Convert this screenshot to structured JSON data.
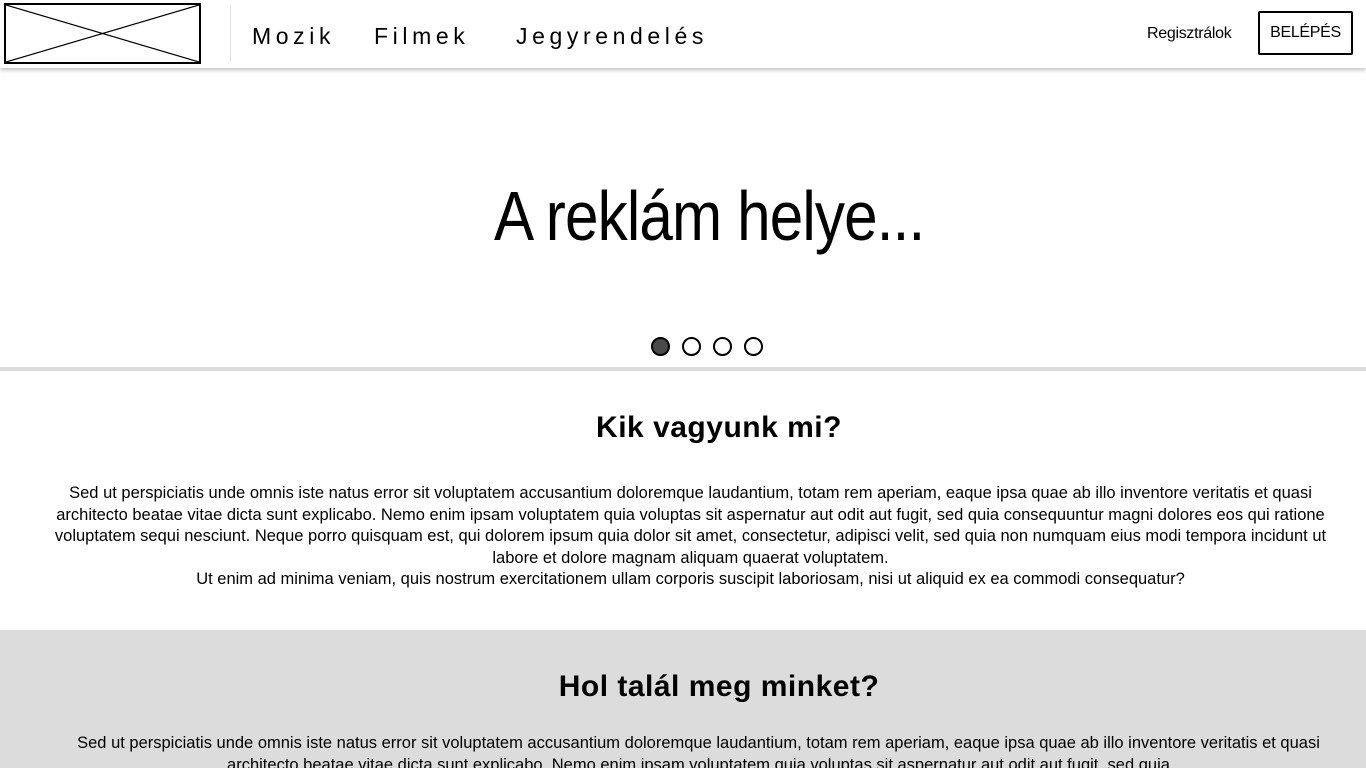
{
  "header": {
    "logo_alt": "",
    "nav": [
      {
        "label": "Mozik"
      },
      {
        "label": "Filmek"
      },
      {
        "label": "Jegyrendelés"
      }
    ],
    "register_label": "Regisztrálok",
    "login_label": "BELÉPÉS"
  },
  "hero": {
    "text": "A reklám helye...",
    "slides_count": 4,
    "active_slide": 1
  },
  "about": {
    "title": "Kik vagyunk mi?",
    "paragraph1": "Sed ut perspiciatis unde omnis iste natus error sit voluptatem accusantium doloremque laudantium, totam rem aperiam, eaque ipsa quae ab illo inventore veritatis et quasi architecto beatae vitae dicta sunt explicabo. Nemo enim ipsam voluptatem quia voluptas sit aspernatur aut odit aut fugit, sed quia consequuntur magni dolores eos qui ratione voluptatem sequi nesciunt. Neque porro quisquam est, qui dolorem ipsum quia dolor sit amet, consectetur, adipisci velit, sed quia non numquam eius modi tempora incidunt ut labore et dolore magnam aliquam quaerat voluptatem.",
    "paragraph2": "Ut enim ad minima veniam, quis nostrum exercitationem ullam corporis suscipit laboriosam, nisi ut aliquid ex ea commodi consequatur?"
  },
  "location": {
    "title": "Hol talál meg minket?",
    "paragraph1": "Sed ut perspiciatis unde omnis iste natus error sit voluptatem accusantium doloremque laudantium, totam rem aperiam, eaque ipsa quae ab illo inventore veritatis et quasi architecto beatae vitae dicta sunt explicabo. Nemo enim ipsam voluptatem quia voluptas sit aspernatur aut odit aut fugit, sed quia"
  },
  "colors": {
    "background": "#ffffff",
    "section_gray": "#dcdcdc",
    "text": "#000000",
    "active_dot": "#4a4a4a"
  }
}
